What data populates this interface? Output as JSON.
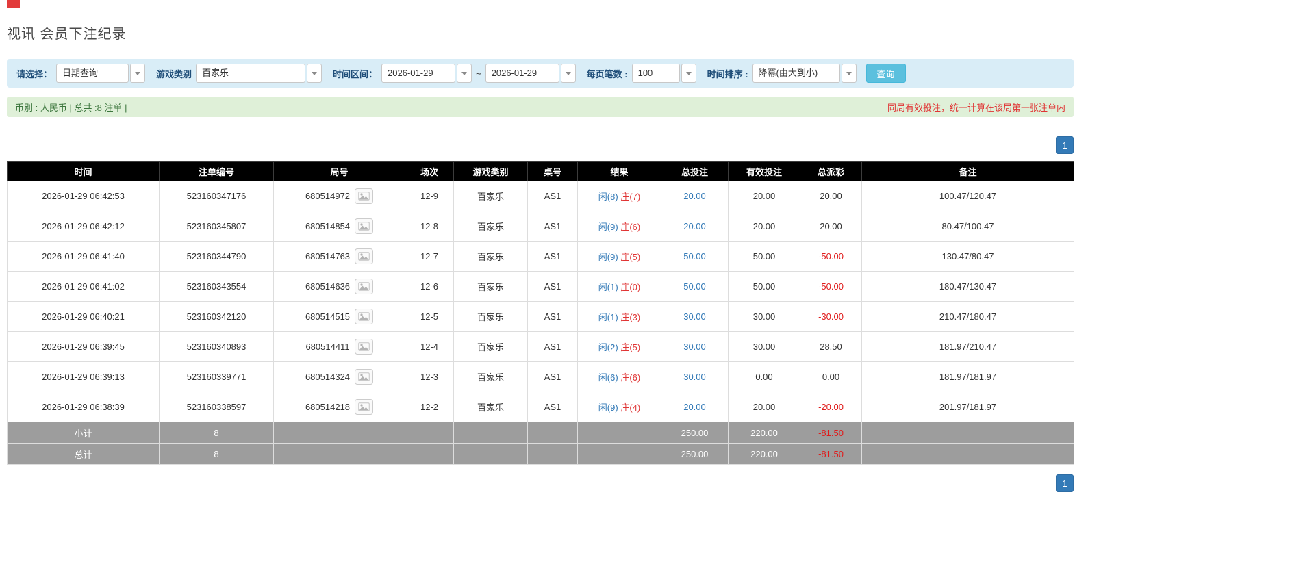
{
  "page": {
    "title": "视讯 会员下注纪录"
  },
  "filters": {
    "select_label": "请选择：",
    "select_value": "日期查询",
    "game_type_label": "游戏类别",
    "game_type_value": "百家乐",
    "date_range_label": "时间区间：",
    "date_from": "2026-01-29",
    "date_separator": "~",
    "date_to": "2026-01-29",
    "page_size_label": "每页笔数 :",
    "page_size_value": "100",
    "sort_label": "时间排序 :",
    "sort_value": "降冪(由大到小)",
    "search_button": "查询"
  },
  "summary": {
    "currency_info": "币別 : 人民币 | 总共 :8 注单 |",
    "note": "同局有效投注，统一计算在该局第一张注单内"
  },
  "pagination": {
    "page": "1"
  },
  "icons": {
    "combo_dropdown": "chevron-down",
    "round_media": "image-thumbnail"
  },
  "colors": {
    "link_blue": "#337ab7",
    "banker_red": "#e03434",
    "negative_red": "#e01b1b",
    "header_bg": "#000000",
    "footer_bg": "#9d9d9d",
    "filter_bg": "#d9edf7",
    "summary_bg": "#dff0d8",
    "search_button_bg": "#5bc0de"
  },
  "table": {
    "headers": [
      "时间",
      "注单编号",
      "局号",
      "场次",
      "游戏类别",
      "桌号",
      "结果",
      "总投注",
      "有效投注",
      "总派彩",
      "备注"
    ],
    "rows": [
      {
        "time": "2026-01-29 06:42:53",
        "bet_id": "523160347176",
        "round_id": "680514972",
        "session": "12-9",
        "game_type": "百家乐",
        "table_no": "AS1",
        "result_player": "闲(8)",
        "result_banker": "庄(7)",
        "total_bet": "20.00",
        "valid_bet": "20.00",
        "payout": "20.00",
        "remark": "100.47/120.47"
      },
      {
        "time": "2026-01-29 06:42:12",
        "bet_id": "523160345807",
        "round_id": "680514854",
        "session": "12-8",
        "game_type": "百家乐",
        "table_no": "AS1",
        "result_player": "闲(9)",
        "result_banker": "庄(6)",
        "total_bet": "20.00",
        "valid_bet": "20.00",
        "payout": "20.00",
        "remark": "80.47/100.47"
      },
      {
        "time": "2026-01-29 06:41:40",
        "bet_id": "523160344790",
        "round_id": "680514763",
        "session": "12-7",
        "game_type": "百家乐",
        "table_no": "AS1",
        "result_player": "闲(9)",
        "result_banker": "庄(5)",
        "total_bet": "50.00",
        "valid_bet": "50.00",
        "payout": "-50.00",
        "remark": "130.47/80.47"
      },
      {
        "time": "2026-01-29 06:41:02",
        "bet_id": "523160343554",
        "round_id": "680514636",
        "session": "12-6",
        "game_type": "百家乐",
        "table_no": "AS1",
        "result_player": "闲(1)",
        "result_banker": "庄(0)",
        "total_bet": "50.00",
        "valid_bet": "50.00",
        "payout": "-50.00",
        "remark": "180.47/130.47"
      },
      {
        "time": "2026-01-29 06:40:21",
        "bet_id": "523160342120",
        "round_id": "680514515",
        "session": "12-5",
        "game_type": "百家乐",
        "table_no": "AS1",
        "result_player": "闲(1)",
        "result_banker": "庄(3)",
        "total_bet": "30.00",
        "valid_bet": "30.00",
        "payout": "-30.00",
        "remark": "210.47/180.47"
      },
      {
        "time": "2026-01-29 06:39:45",
        "bet_id": "523160340893",
        "round_id": "680514411",
        "session": "12-4",
        "game_type": "百家乐",
        "table_no": "AS1",
        "result_player": "闲(2)",
        "result_banker": "庄(5)",
        "total_bet": "30.00",
        "valid_bet": "30.00",
        "payout": "28.50",
        "remark": "181.97/210.47"
      },
      {
        "time": "2026-01-29 06:39:13",
        "bet_id": "523160339771",
        "round_id": "680514324",
        "session": "12-3",
        "game_type": "百家乐",
        "table_no": "AS1",
        "result_player": "闲(6)",
        "result_banker": "庄(6)",
        "total_bet": "30.00",
        "valid_bet": "0.00",
        "payout": "0.00",
        "remark": "181.97/181.97"
      },
      {
        "time": "2026-01-29 06:38:39",
        "bet_id": "523160338597",
        "round_id": "680514218",
        "session": "12-2",
        "game_type": "百家乐",
        "table_no": "AS1",
        "result_player": "闲(9)",
        "result_banker": "庄(4)",
        "total_bet": "20.00",
        "valid_bet": "20.00",
        "payout": "-20.00",
        "remark": "201.97/181.97"
      }
    ],
    "footer_rows": [
      {
        "label": "小计",
        "count": "8",
        "total_bet": "250.00",
        "valid_bet": "220.00",
        "payout": "-81.50"
      },
      {
        "label": "总计",
        "count": "8",
        "total_bet": "250.00",
        "valid_bet": "220.00",
        "payout": "-81.50"
      }
    ]
  }
}
